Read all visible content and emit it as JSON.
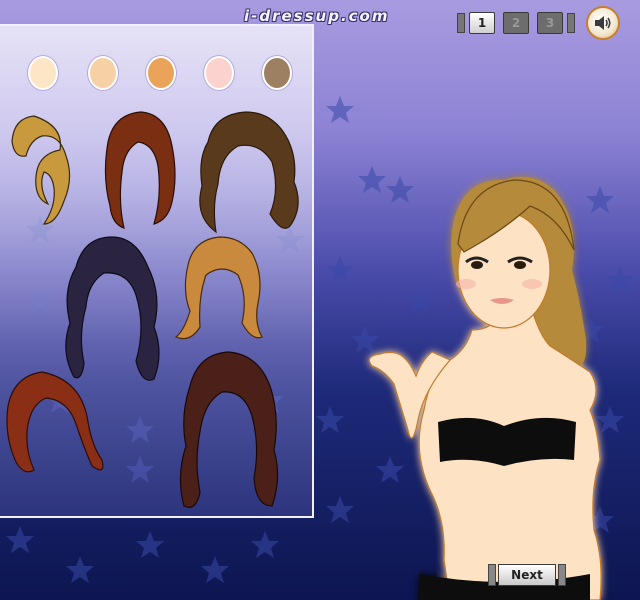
{
  "site": {
    "logo": "i-dressup.com"
  },
  "pager": {
    "pages": [
      "1",
      "2",
      "3"
    ],
    "current": "1"
  },
  "sound": {
    "icon": "speaker-icon"
  },
  "skin_tones": [
    {
      "id": "fair",
      "color": "#fde6c6"
    },
    {
      "id": "light",
      "color": "#f6d1a6"
    },
    {
      "id": "tan",
      "color": "#e9a45a"
    },
    {
      "id": "pink",
      "color": "#fbd2ce"
    },
    {
      "id": "dark",
      "color": "#9d8062"
    }
  ],
  "hairstyles": [
    {
      "id": "blonde-ponytail",
      "color": "#c89a3d",
      "style": "ponytail"
    },
    {
      "id": "auburn-long-straight",
      "color": "#7a2e12",
      "style": "long"
    },
    {
      "id": "brown-wavy-medium",
      "color": "#5a3a1c",
      "style": "wavy"
    },
    {
      "id": "black-curly-long",
      "color": "#2a2440",
      "style": "curly"
    },
    {
      "id": "caramel-flip",
      "color": "#c98a3d",
      "style": "flip"
    },
    {
      "id": "red-side-swept",
      "color": "#8a2e16",
      "style": "side"
    },
    {
      "id": "dark-brown-long-wavy",
      "color": "#4a2018",
      "style": "longwavy"
    }
  ],
  "model": {
    "hair_color": "#b58a3a",
    "skin_color": "#fde3c3",
    "top_color": "#111111"
  },
  "footer": {
    "next_label": "Next"
  }
}
